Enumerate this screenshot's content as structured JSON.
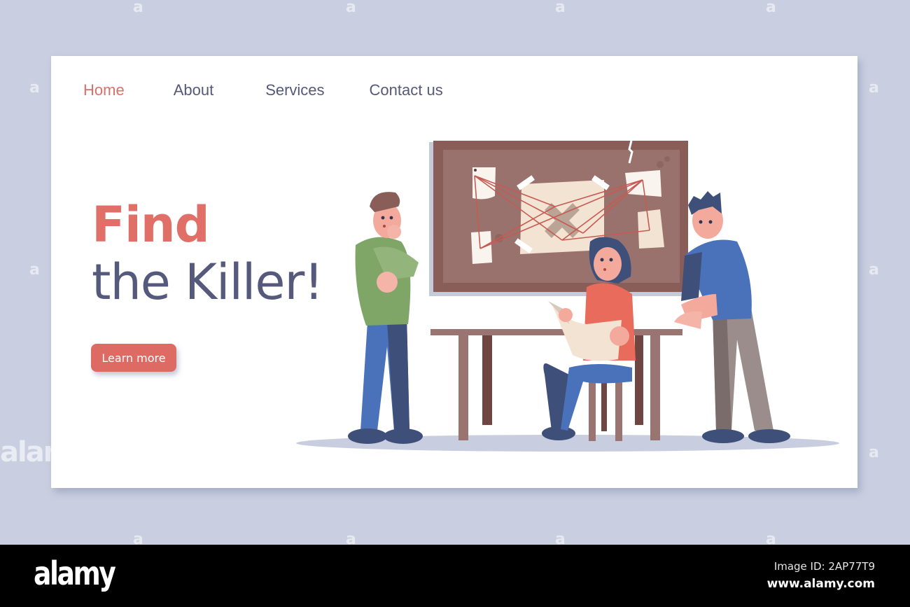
{
  "nav": {
    "items": [
      {
        "label": "Home",
        "active": true
      },
      {
        "label": "About",
        "active": false
      },
      {
        "label": "Services",
        "active": false
      },
      {
        "label": "Contact us",
        "active": false
      }
    ]
  },
  "hero": {
    "title_line1": "Find",
    "title_line2": "the Killer!",
    "cta_label": "Learn more"
  },
  "illustration": {
    "description": "Three detectives investigating at an evidence board with red strings, a woman reading a newspaper at a table",
    "elements": [
      "evidence-board",
      "red-strings",
      "pinned-notes",
      "map-with-x",
      "detective-green",
      "detective-woman",
      "detective-blue",
      "table",
      "stool",
      "floor-shadow"
    ]
  },
  "colors": {
    "accent": "#dd6b63",
    "heading_dark": "#555a7c",
    "nav_text": "#55597a",
    "background": "#c9cfe0",
    "card": "#ffffff",
    "board_frame": "#8a5e58",
    "board_cork": "#9a726d"
  },
  "watermark": {
    "glyph": "a",
    "logo": "alamy",
    "image_id": "Image ID: 2AP77T9",
    "url": "www.alamy.com"
  }
}
